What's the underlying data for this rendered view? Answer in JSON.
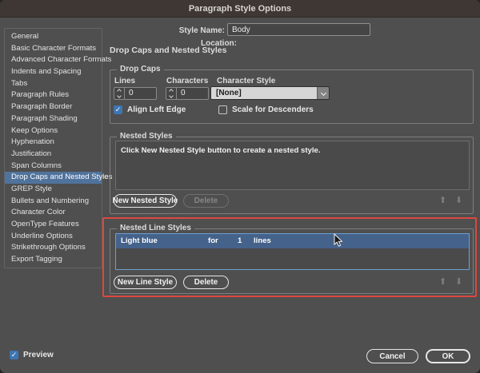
{
  "window": {
    "title": "Paragraph Style Options"
  },
  "header": {
    "style_name_label": "Style Name:",
    "style_name_value": "Body",
    "location_label": "Location:"
  },
  "sidebar": {
    "items": [
      "General",
      "Basic Character Formats",
      "Advanced Character Formats",
      "Indents and Spacing",
      "Tabs",
      "Paragraph Rules",
      "Paragraph Border",
      "Paragraph Shading",
      "Keep Options",
      "Hyphenation",
      "Justification",
      "Span Columns",
      "Drop Caps and Nested Styles",
      "GREP Style",
      "Bullets and Numbering",
      "Character Color",
      "OpenType Features",
      "Underline Options",
      "Strikethrough Options",
      "Export Tagging"
    ],
    "selected_item": "Drop Caps and Nested Styles"
  },
  "main": {
    "heading": "Drop Caps and Nested Styles",
    "drop_caps": {
      "legend": "Drop Caps",
      "lines_label": "Lines",
      "lines_value": "0",
      "characters_label": "Characters",
      "characters_value": "0",
      "character_style_label": "Character Style",
      "character_style_value": "[None]",
      "align_left_edge_label": "Align Left Edge",
      "align_left_edge_checked": true,
      "scale_for_descenders_label": "Scale for Descenders",
      "scale_for_descenders_checked": false
    },
    "nested_styles": {
      "legend": "Nested Styles",
      "hint": "Click New Nested Style button to create a nested style.",
      "new_button_label": "New Nested Style",
      "delete_button_label": "Delete"
    },
    "nested_line_styles": {
      "legend": "Nested Line Styles",
      "row": {
        "style_name": "Light blue",
        "keyword": "for",
        "count": "1",
        "unit": "lines"
      },
      "new_button_label": "New Line Style",
      "delete_button_label": "Delete"
    }
  },
  "footer": {
    "preview_label": "Preview",
    "preview_checked": true,
    "cancel_label": "Cancel",
    "ok_label": "OK"
  },
  "colors": {
    "titlebar": "#3e3734",
    "dialog_bg": "#4f4f4f",
    "sidebar_selection_blue": "#50739c",
    "row_selection_blue": "#44628a",
    "checkbox_blue": "#3d76b3",
    "annotation_red": "#dd4740",
    "focus_border_blue": "#6f9fd0",
    "dropdown_light": "#d6d6d6"
  }
}
